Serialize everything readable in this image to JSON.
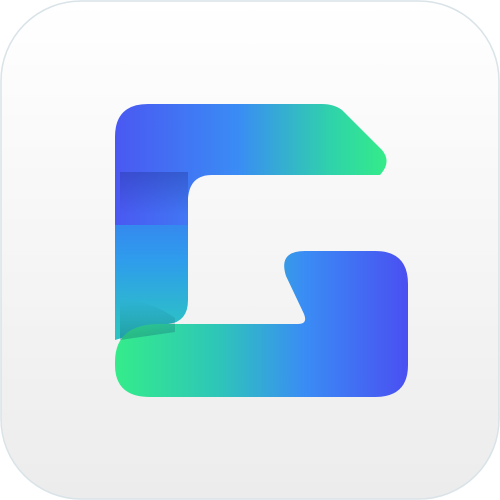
{
  "app_icon": {
    "name": "g-logo-icon",
    "colors": {
      "tile_top": "#ffffff",
      "tile_bottom": "#ececec",
      "tile_edge": "#d9e3e8",
      "green": "#34e88c",
      "cyan": "#2ec9b0",
      "blue": "#3a8cf5",
      "indigo": "#4a55f2",
      "violet": "#5046f0"
    }
  }
}
